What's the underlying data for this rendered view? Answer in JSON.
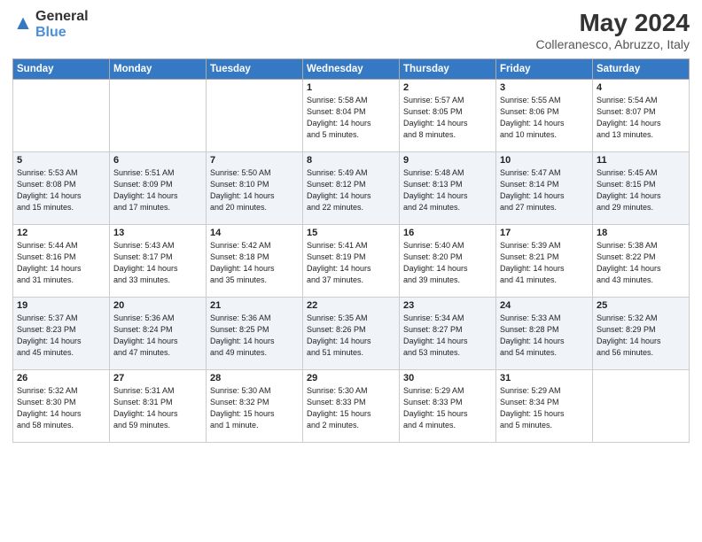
{
  "header": {
    "logo_line1": "General",
    "logo_line2": "Blue",
    "title": "May 2024",
    "subtitle": "Colleranesco, Abruzzo, Italy"
  },
  "days_of_week": [
    "Sunday",
    "Monday",
    "Tuesday",
    "Wednesday",
    "Thursday",
    "Friday",
    "Saturday"
  ],
  "weeks": [
    [
      {
        "num": "",
        "info": ""
      },
      {
        "num": "",
        "info": ""
      },
      {
        "num": "",
        "info": ""
      },
      {
        "num": "1",
        "info": "Sunrise: 5:58 AM\nSunset: 8:04 PM\nDaylight: 14 hours\nand 5 minutes."
      },
      {
        "num": "2",
        "info": "Sunrise: 5:57 AM\nSunset: 8:05 PM\nDaylight: 14 hours\nand 8 minutes."
      },
      {
        "num": "3",
        "info": "Sunrise: 5:55 AM\nSunset: 8:06 PM\nDaylight: 14 hours\nand 10 minutes."
      },
      {
        "num": "4",
        "info": "Sunrise: 5:54 AM\nSunset: 8:07 PM\nDaylight: 14 hours\nand 13 minutes."
      }
    ],
    [
      {
        "num": "5",
        "info": "Sunrise: 5:53 AM\nSunset: 8:08 PM\nDaylight: 14 hours\nand 15 minutes."
      },
      {
        "num": "6",
        "info": "Sunrise: 5:51 AM\nSunset: 8:09 PM\nDaylight: 14 hours\nand 17 minutes."
      },
      {
        "num": "7",
        "info": "Sunrise: 5:50 AM\nSunset: 8:10 PM\nDaylight: 14 hours\nand 20 minutes."
      },
      {
        "num": "8",
        "info": "Sunrise: 5:49 AM\nSunset: 8:12 PM\nDaylight: 14 hours\nand 22 minutes."
      },
      {
        "num": "9",
        "info": "Sunrise: 5:48 AM\nSunset: 8:13 PM\nDaylight: 14 hours\nand 24 minutes."
      },
      {
        "num": "10",
        "info": "Sunrise: 5:47 AM\nSunset: 8:14 PM\nDaylight: 14 hours\nand 27 minutes."
      },
      {
        "num": "11",
        "info": "Sunrise: 5:45 AM\nSunset: 8:15 PM\nDaylight: 14 hours\nand 29 minutes."
      }
    ],
    [
      {
        "num": "12",
        "info": "Sunrise: 5:44 AM\nSunset: 8:16 PM\nDaylight: 14 hours\nand 31 minutes."
      },
      {
        "num": "13",
        "info": "Sunrise: 5:43 AM\nSunset: 8:17 PM\nDaylight: 14 hours\nand 33 minutes."
      },
      {
        "num": "14",
        "info": "Sunrise: 5:42 AM\nSunset: 8:18 PM\nDaylight: 14 hours\nand 35 minutes."
      },
      {
        "num": "15",
        "info": "Sunrise: 5:41 AM\nSunset: 8:19 PM\nDaylight: 14 hours\nand 37 minutes."
      },
      {
        "num": "16",
        "info": "Sunrise: 5:40 AM\nSunset: 8:20 PM\nDaylight: 14 hours\nand 39 minutes."
      },
      {
        "num": "17",
        "info": "Sunrise: 5:39 AM\nSunset: 8:21 PM\nDaylight: 14 hours\nand 41 minutes."
      },
      {
        "num": "18",
        "info": "Sunrise: 5:38 AM\nSunset: 8:22 PM\nDaylight: 14 hours\nand 43 minutes."
      }
    ],
    [
      {
        "num": "19",
        "info": "Sunrise: 5:37 AM\nSunset: 8:23 PM\nDaylight: 14 hours\nand 45 minutes."
      },
      {
        "num": "20",
        "info": "Sunrise: 5:36 AM\nSunset: 8:24 PM\nDaylight: 14 hours\nand 47 minutes."
      },
      {
        "num": "21",
        "info": "Sunrise: 5:36 AM\nSunset: 8:25 PM\nDaylight: 14 hours\nand 49 minutes."
      },
      {
        "num": "22",
        "info": "Sunrise: 5:35 AM\nSunset: 8:26 PM\nDaylight: 14 hours\nand 51 minutes."
      },
      {
        "num": "23",
        "info": "Sunrise: 5:34 AM\nSunset: 8:27 PM\nDaylight: 14 hours\nand 53 minutes."
      },
      {
        "num": "24",
        "info": "Sunrise: 5:33 AM\nSunset: 8:28 PM\nDaylight: 14 hours\nand 54 minutes."
      },
      {
        "num": "25",
        "info": "Sunrise: 5:32 AM\nSunset: 8:29 PM\nDaylight: 14 hours\nand 56 minutes."
      }
    ],
    [
      {
        "num": "26",
        "info": "Sunrise: 5:32 AM\nSunset: 8:30 PM\nDaylight: 14 hours\nand 58 minutes."
      },
      {
        "num": "27",
        "info": "Sunrise: 5:31 AM\nSunset: 8:31 PM\nDaylight: 14 hours\nand 59 minutes."
      },
      {
        "num": "28",
        "info": "Sunrise: 5:30 AM\nSunset: 8:32 PM\nDaylight: 15 hours\nand 1 minute."
      },
      {
        "num": "29",
        "info": "Sunrise: 5:30 AM\nSunset: 8:33 PM\nDaylight: 15 hours\nand 2 minutes."
      },
      {
        "num": "30",
        "info": "Sunrise: 5:29 AM\nSunset: 8:33 PM\nDaylight: 15 hours\nand 4 minutes."
      },
      {
        "num": "31",
        "info": "Sunrise: 5:29 AM\nSunset: 8:34 PM\nDaylight: 15 hours\nand 5 minutes."
      },
      {
        "num": "",
        "info": ""
      }
    ]
  ]
}
